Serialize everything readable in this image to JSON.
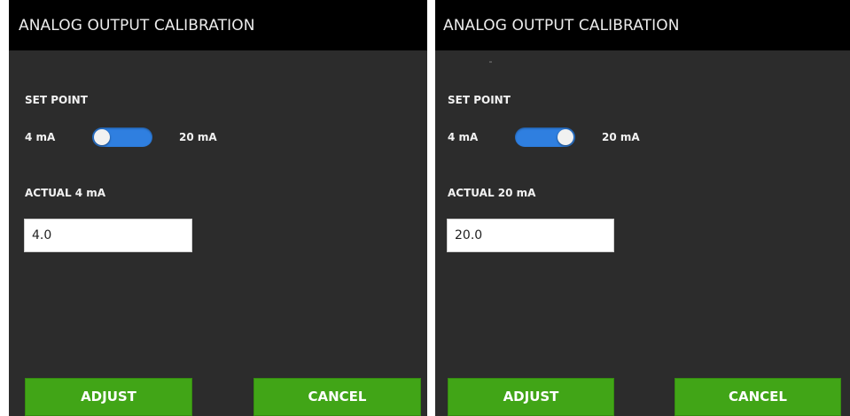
{
  "screens": [
    {
      "title": "ANALOG OUTPUT CALIBRATION",
      "set_point_label": "SET POINT",
      "low_option": "4 mA",
      "high_option": "20 mA",
      "toggle_state": "4 mA",
      "actual_label": "ACTUAL 4 mA",
      "actual_value": "4.0",
      "adjust_label": "ADJUST",
      "cancel_label": "CANCEL"
    },
    {
      "title": "ANALOG OUTPUT CALIBRATION",
      "set_point_label": "SET POINT",
      "low_option": "4 mA",
      "high_option": "20 mA",
      "toggle_state": "20 mA",
      "actual_label": "ACTUAL 20 mA",
      "actual_value": "20.0",
      "adjust_label": "ADJUST",
      "cancel_label": "CANCEL"
    }
  ],
  "colors": {
    "title_bar": "#000000",
    "panel_background": "#2c2c2c",
    "toggle_accent": "#2f7fe0",
    "button_green": "#41a517"
  }
}
